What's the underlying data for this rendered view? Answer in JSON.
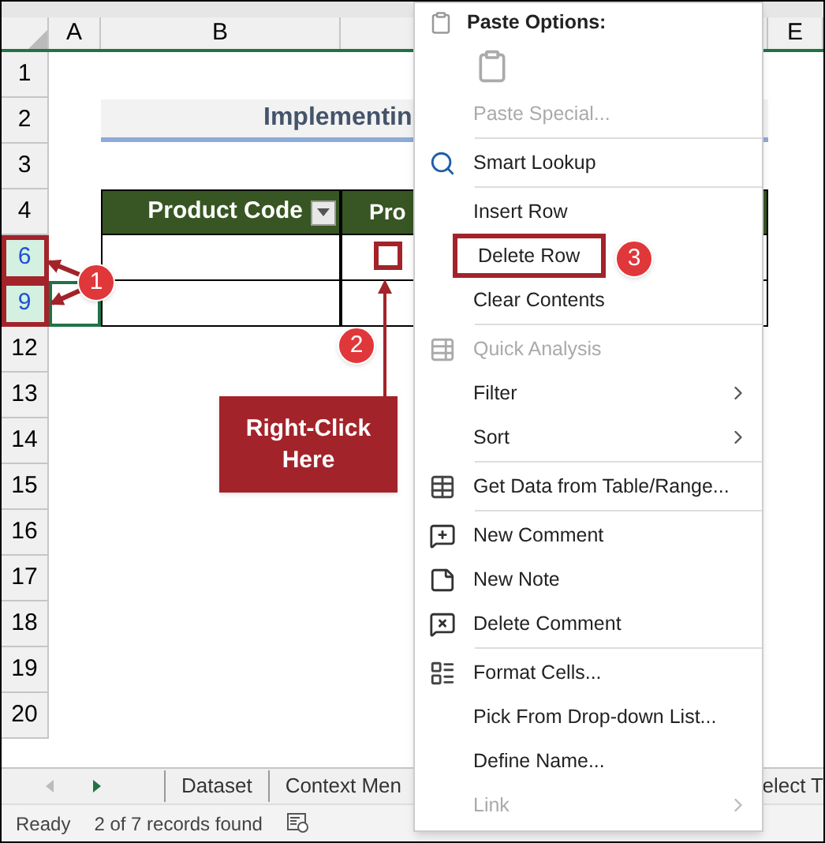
{
  "columns": [
    {
      "label": "A"
    },
    {
      "label": "B"
    },
    {
      "label": "E"
    }
  ],
  "title": "Implementin",
  "table": {
    "columns": [
      "Product Code",
      "Pro"
    ]
  },
  "rows": [
    {
      "label": "1",
      "selected": false,
      "outlined": false
    },
    {
      "label": "2",
      "selected": false,
      "outlined": false
    },
    {
      "label": "3",
      "selected": false,
      "outlined": false
    },
    {
      "label": "4",
      "selected": false,
      "outlined": false
    },
    {
      "label": "6",
      "selected": true,
      "outlined": true
    },
    {
      "label": "9",
      "selected": true,
      "outlined": true
    },
    {
      "label": "12",
      "selected": false,
      "outlined": false
    },
    {
      "label": "13",
      "selected": false,
      "outlined": false
    },
    {
      "label": "14",
      "selected": false,
      "outlined": false
    },
    {
      "label": "15",
      "selected": false,
      "outlined": false
    },
    {
      "label": "16",
      "selected": false,
      "outlined": false
    },
    {
      "label": "17",
      "selected": false,
      "outlined": false
    },
    {
      "label": "18",
      "selected": false,
      "outlined": false
    },
    {
      "label": "19",
      "selected": false,
      "outlined": false
    },
    {
      "label": "20",
      "selected": false,
      "outlined": false
    }
  ],
  "context_menu": {
    "header": "Paste Options:",
    "items": [
      {
        "kind": "item",
        "label": "Paste Special...",
        "disabled": true,
        "submenu": false,
        "outlined": false
      },
      {
        "kind": "divider"
      },
      {
        "kind": "item",
        "label": "Smart Lookup",
        "disabled": false,
        "submenu": false,
        "outlined": false
      },
      {
        "kind": "divider"
      },
      {
        "kind": "item",
        "label": "Insert Row",
        "disabled": false,
        "submenu": false,
        "outlined": false
      },
      {
        "kind": "item",
        "label": "Delete Row",
        "disabled": false,
        "submenu": false,
        "outlined": true
      },
      {
        "kind": "item",
        "label": "Clear Contents",
        "disabled": false,
        "submenu": false,
        "outlined": false
      },
      {
        "kind": "divider"
      },
      {
        "kind": "item",
        "label": "Quick Analysis",
        "disabled": true,
        "submenu": false,
        "outlined": false
      },
      {
        "kind": "item",
        "label": "Filter",
        "disabled": false,
        "submenu": true,
        "outlined": false
      },
      {
        "kind": "item",
        "label": "Sort",
        "disabled": false,
        "submenu": true,
        "outlined": false
      },
      {
        "kind": "divider"
      },
      {
        "kind": "item",
        "label": "Get Data from Table/Range...",
        "disabled": false,
        "submenu": false,
        "outlined": false
      },
      {
        "kind": "divider"
      },
      {
        "kind": "item",
        "label": "New Comment",
        "disabled": false,
        "submenu": false,
        "outlined": false
      },
      {
        "kind": "item",
        "label": "New Note",
        "disabled": false,
        "submenu": false,
        "outlined": false
      },
      {
        "kind": "item",
        "label": "Delete Comment",
        "disabled": false,
        "submenu": false,
        "outlined": false
      },
      {
        "kind": "divider"
      },
      {
        "kind": "item",
        "label": "Format Cells...",
        "disabled": false,
        "submenu": false,
        "outlined": false
      },
      {
        "kind": "item",
        "label": "Pick From Drop-down List...",
        "disabled": false,
        "submenu": false,
        "outlined": false
      },
      {
        "kind": "item",
        "label": "Define Name...",
        "disabled": false,
        "submenu": false,
        "outlined": false
      },
      {
        "kind": "item",
        "label": "Link",
        "disabled": true,
        "submenu": true,
        "outlined": false
      }
    ]
  },
  "callout": "Right-Click Here",
  "steps": [
    "1",
    "2",
    "3"
  ],
  "sheet_tabs": [
    {
      "label": "Dataset",
      "selected": false
    },
    {
      "label": "Context Men",
      "selected": false
    },
    {
      "label": "elect T",
      "selected": false
    }
  ],
  "status_bar": {
    "mode": "Ready",
    "records": "2 of 7 records found"
  }
}
